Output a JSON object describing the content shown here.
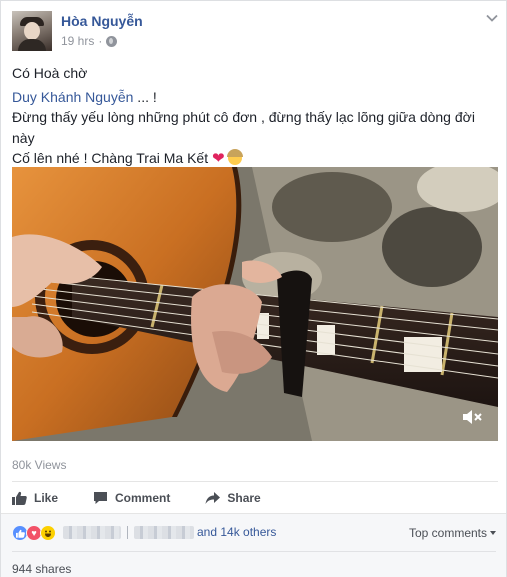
{
  "post": {
    "author": "Hòa Nguyễn",
    "time": "19 hrs",
    "privacy_icon": "globe-icon",
    "lines": [
      "Có Hoà chờ",
      "Duy Khánh Nguyễn",
      " ... !",
      "Đừng thấy yếu lòng những phút cô đơn , đừng thấy lạc lõng giữa dòng đời này",
      "Cố lên nhé ! Chàng Trai Ma Kết "
    ],
    "views": "80k Views"
  },
  "actions": {
    "like": "Like",
    "comment": "Comment",
    "share": "Share"
  },
  "footer": {
    "others": "and 14k others",
    "top_comments": "Top comments",
    "shares": "944 shares"
  },
  "colors": {
    "link": "#365899",
    "meta": "#90949c",
    "heart": "#e0245e"
  }
}
